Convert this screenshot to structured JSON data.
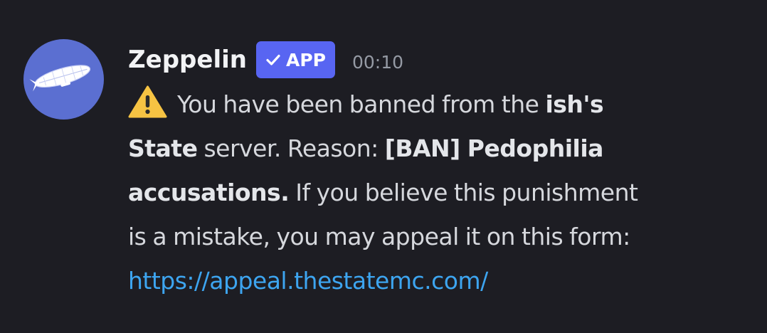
{
  "message": {
    "author": {
      "name": "Zeppelin",
      "badge_label": "APP",
      "avatar_icon": "zeppelin-airship-icon",
      "avatar_color": "#5b6fd1"
    },
    "timestamp": "00:10",
    "warning_icon": "warning-triangle-icon",
    "text": {
      "part1": "You have been banned from the ",
      "server_name_a": "ish's",
      "server_name_b": "State",
      "part2": " server. Reason: ",
      "reason_a": "[BAN] Pedophilia",
      "reason_b": "accusations.",
      "part3": " If you believe this punishment",
      "part4": "is a mistake, you may appeal it on this form:",
      "link": "https://appeal.thestatemc.com/"
    }
  },
  "colors": {
    "background": "#1d1d23",
    "badge": "#5865f2",
    "link": "#3da5f0",
    "text": "#d6d8dd",
    "timestamp": "#959aa4"
  }
}
